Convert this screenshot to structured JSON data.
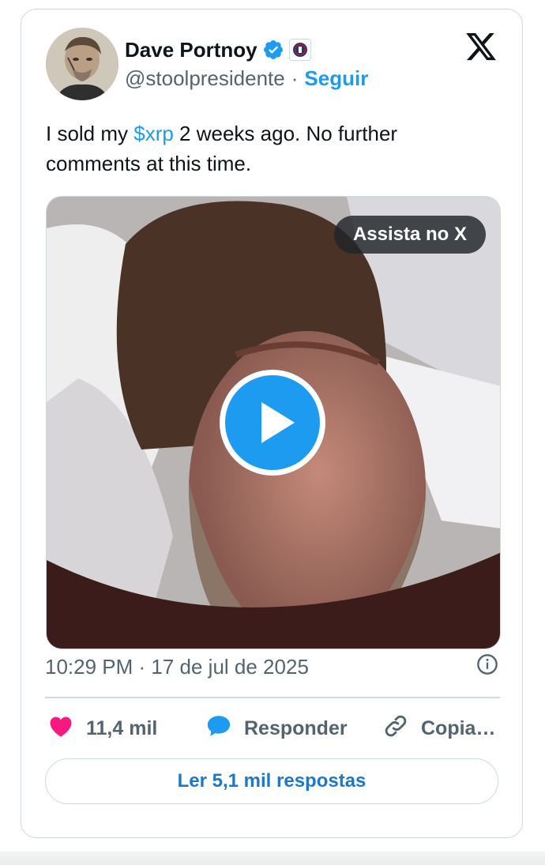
{
  "author": {
    "name": "Dave Portnoy",
    "handle": "@stoolpresidente",
    "separator": "·",
    "follow_label": "Seguir",
    "avatar_icon": "avatar-photo",
    "verified_icon": "verified-badge-icon",
    "affiliate_icon": "barstool-affiliate-icon"
  },
  "platform_icon": "x-logo-icon",
  "tweet": {
    "text_before": "I sold my ",
    "cashtag": "$xrp",
    "text_after": " 2 weeks ago.  No further comments at this time."
  },
  "media": {
    "watch_label": "Assista no X",
    "play_icon": "play-icon"
  },
  "meta": {
    "timestamp": "10:29 PM · 17 de jul de 2025",
    "info_icon": "info-icon"
  },
  "actions": {
    "like_count": "11,4 mil",
    "reply_label": "Responder",
    "copy_label": "Copia…"
  },
  "read_replies_label": "Ler 5,1 mil respostas",
  "colors": {
    "accent": "#1d9bf0",
    "like": "#f91880",
    "text_secondary": "#536471",
    "border": "#cfd9de"
  }
}
